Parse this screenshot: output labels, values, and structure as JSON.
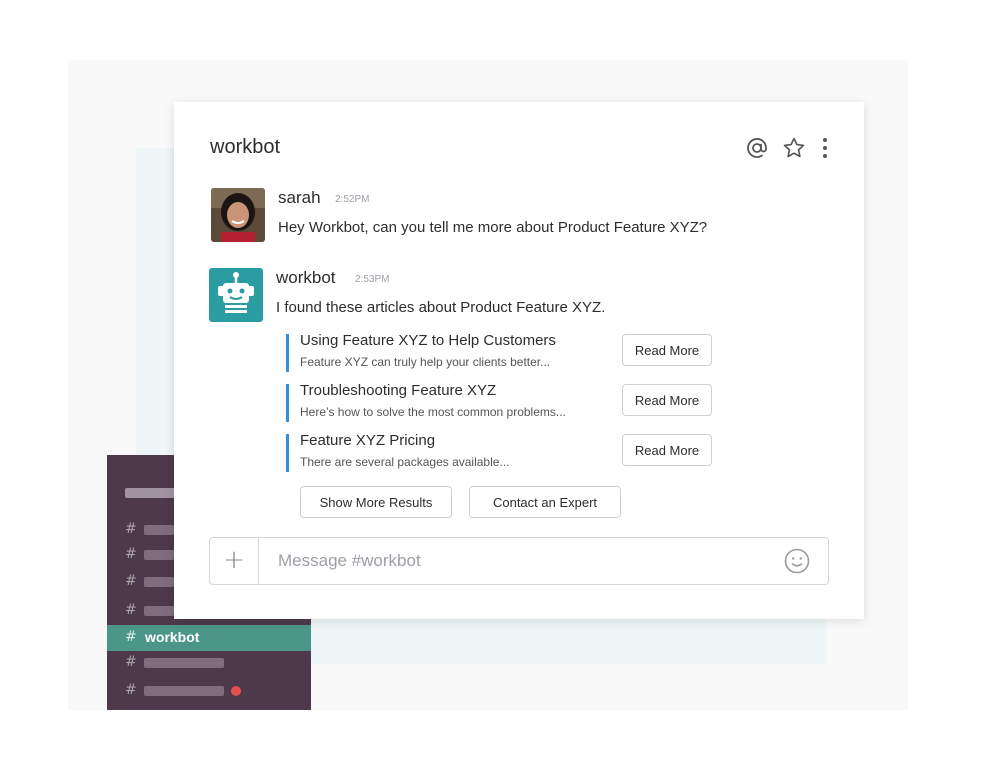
{
  "channel": {
    "title": "workbot"
  },
  "header_icons": [
    "at-icon",
    "star-icon",
    "more-vertical-icon"
  ],
  "messages": [
    {
      "author": "sarah",
      "time": "2:52PM",
      "text": "Hey Workbot, can you tell me more about Product Feature XYZ?"
    },
    {
      "author": "workbot",
      "time": "2:53PM",
      "text": "I found these articles about Product Feature XYZ.",
      "attachments": [
        {
          "title": "Using Feature XYZ to Help Customers",
          "description": "Feature XYZ can truly help your clients better...",
          "button": "Read More"
        },
        {
          "title": "Troubleshooting Feature XYZ",
          "description": "Here’s how to solve the most common problems...",
          "button": "Read More"
        },
        {
          "title": "Feature XYZ Pricing",
          "description": "There are several packages available...",
          "button": "Read More"
        }
      ],
      "actions": {
        "show_more": "Show More Results",
        "contact": "Contact an Expert"
      }
    }
  ],
  "composer": {
    "placeholder": "Message #workbot"
  },
  "sidebar": {
    "hash": "#",
    "active_channel": "workbot",
    "unread_color": "#e24f51"
  },
  "colors": {
    "sidebar_bg": "#4d394b",
    "active_bg": "#4c9689",
    "attachment_bar": "#3a8dde",
    "bot_avatar": "#2b9ca2"
  }
}
